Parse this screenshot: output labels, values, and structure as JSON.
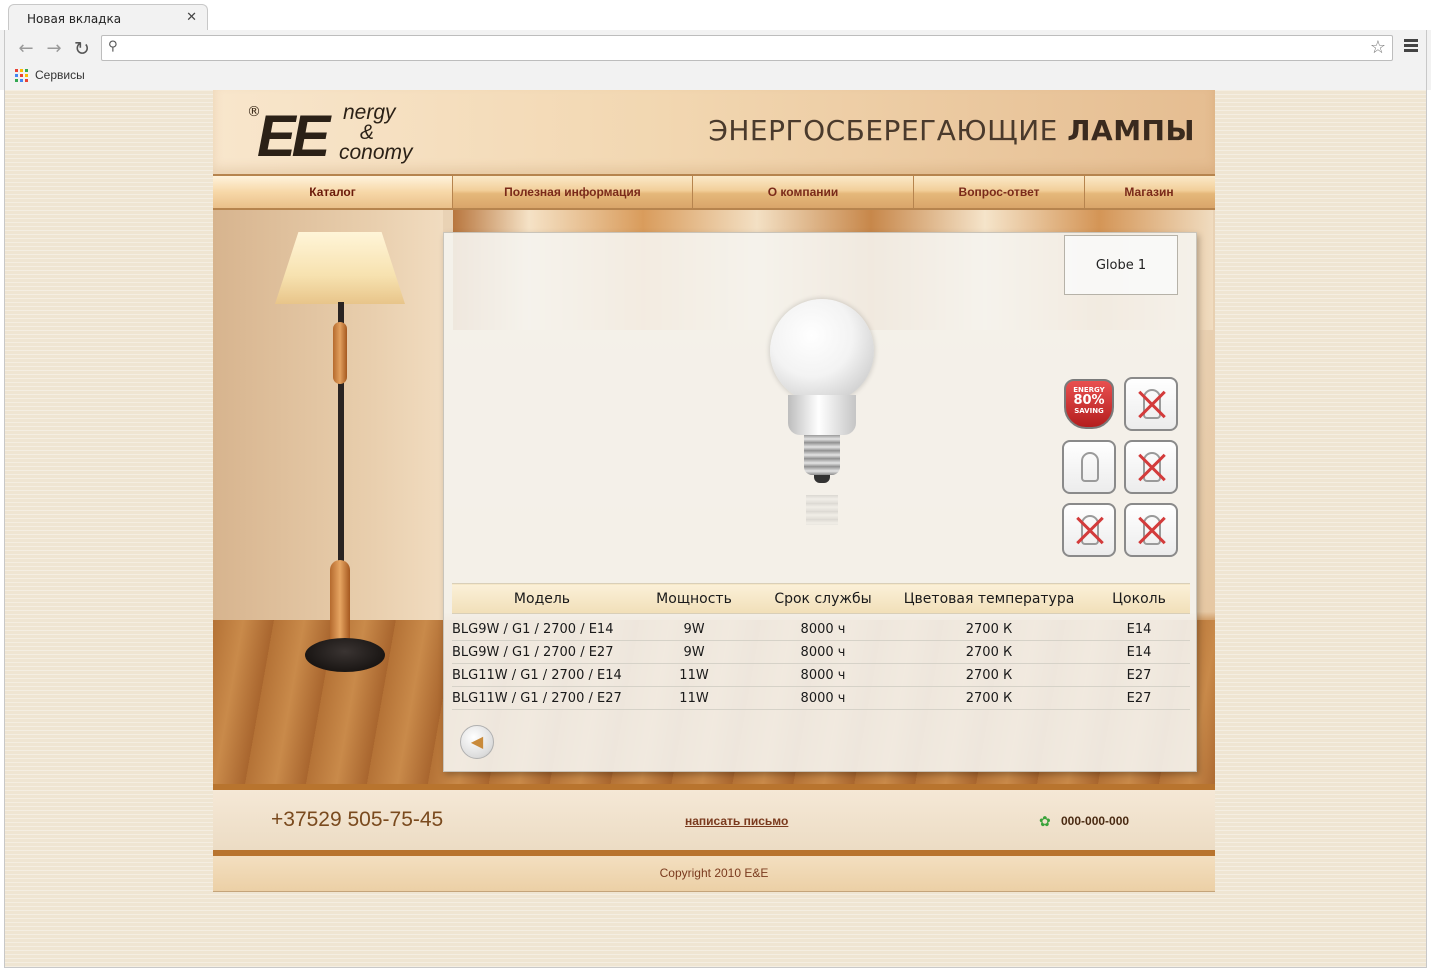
{
  "browser": {
    "tab_title": "Новая вкладка",
    "close_glyph": "✕",
    "address_value": "",
    "bookmark_label": "Сервисы"
  },
  "header": {
    "logo": {
      "reg": "®",
      "ee": "EE",
      "line1": "nergy",
      "line2": "&",
      "line3": "conomy"
    },
    "title_light": "ЭНЕРГОСБЕРЕГАЮЩИЕ ",
    "title_bold": "ЛАМПЫ"
  },
  "nav": [
    {
      "label": "Каталог",
      "active": true
    },
    {
      "label": "Полезная информация",
      "active": false
    },
    {
      "label": "О компании",
      "active": false
    },
    {
      "label": "Вопрос-ответ",
      "active": false
    },
    {
      "label": "Магазин",
      "active": false
    }
  ],
  "product": {
    "name": "Globe 1",
    "badge": {
      "line1": "ENERGY",
      "line2": "80%",
      "line3": "SAVING"
    },
    "feature_icons": [
      "energy-saving-badge-icon",
      "no-moisture-icon",
      "hand-screw-icon",
      "no-hand-grip-icon",
      "no-dimmer-icon",
      "no-enclosed-fixture-icon"
    ]
  },
  "table": {
    "headers": [
      "Модель",
      "Мощность",
      "Срок службы",
      "Цветовая температура",
      "Цоколь"
    ],
    "rows": [
      [
        "BLG9W / G1 / 2700 / E14",
        "9W",
        "8000 ч",
        "2700 К",
        "E14"
      ],
      [
        "BLG9W / G1 / 2700 / E27",
        "9W",
        "8000 ч",
        "2700 К",
        "E14"
      ],
      [
        "BLG11W / G1 / 2700 / E14",
        "11W",
        "8000 ч",
        "2700 К",
        "E27"
      ],
      [
        "BLG11W / G1 / 2700 / E27",
        "11W",
        "8000 ч",
        "2700 К",
        "E27"
      ]
    ]
  },
  "footer": {
    "phone": "+37529 505-75-45",
    "mail_link": "написать письмо",
    "icq": "000-000-000",
    "copyright": "Copyright 2010 E&E"
  },
  "colors": {
    "accent": "#b8742e",
    "nav_text": "#7a2a1a",
    "page_bg": "#efe5d2"
  }
}
